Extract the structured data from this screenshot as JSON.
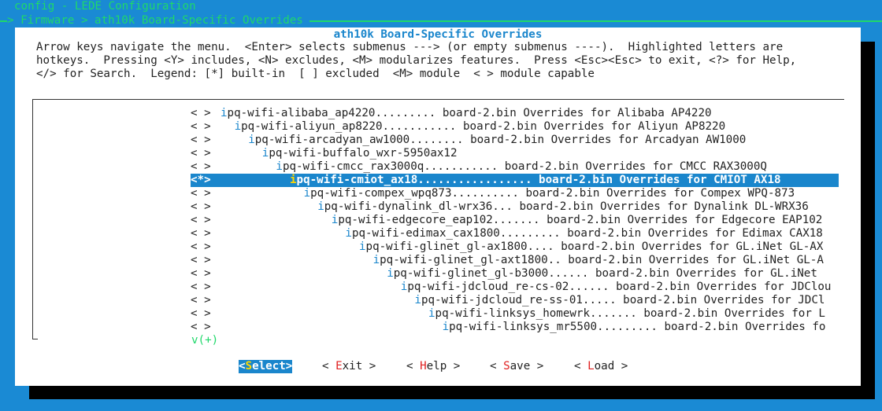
{
  "header": {
    "title": "config - LEDE Configuration",
    "breadcrumb": "> Firmware > ath10k Board-Specific Overrides"
  },
  "dialog": {
    "title": "ath10k Board-Specific Overrides",
    "help_lines": [
      "Arrow keys navigate the menu.  <Enter> selects submenus ---> (or empty submenus ----).  Highlighted letters are",
      "hotkeys.  Pressing <Y> includes, <N> excludes, <M> modularizes features.  Press <Esc><Esc> to exit, <?> for Help,",
      "</> for Search.  Legend: [*] built-in  [ ] excluded  <M> module  < > module capable"
    ]
  },
  "menu": {
    "items": [
      {
        "mark": "< >",
        "hotkey": "i",
        "rest": "pq-wifi-alibaba_ap4220......... board-2.bin Overrides for Alibaba AP4220"
      },
      {
        "mark": "< >",
        "hotkey": "i",
        "rest": "pq-wifi-aliyun_ap8220........... board-2.bin Overrides for Aliyun AP8220"
      },
      {
        "mark": "< >",
        "hotkey": "i",
        "rest": "pq-wifi-arcadyan_aw1000........ board-2.bin Overrides for Arcadyan AW1000"
      },
      {
        "mark": "< >",
        "hotkey": "i",
        "rest": "pq-wifi-buffalo_wxr-5950ax12"
      },
      {
        "mark": "< >",
        "hotkey": "i",
        "rest": "pq-wifi-cmcc_rax3000q........... board-2.bin Overrides for CMCC RAX3000Q"
      },
      {
        "mark": "<*>",
        "hotkey": "i",
        "rest": "pq-wifi-cmiot_ax18................. board-2.bin Overrides for CMIOT AX18",
        "selected": true
      },
      {
        "mark": "< >",
        "hotkey": "i",
        "rest": "pq-wifi-compex_wpq873.......... board-2.bin Overrides for Compex WPQ-873"
      },
      {
        "mark": "< >",
        "hotkey": "i",
        "rest": "pq-wifi-dynalink_dl-wrx36... board-2.bin Overrides for Dynalink DL-WRX36"
      },
      {
        "mark": "< >",
        "hotkey": "i",
        "rest": "pq-wifi-edgecore_eap102....... board-2.bin Overrides for Edgecore EAP102"
      },
      {
        "mark": "< >",
        "hotkey": "i",
        "rest": "pq-wifi-edimax_cax1800......... board-2.bin Overrides for Edimax CAX18"
      },
      {
        "mark": "< >",
        "hotkey": "i",
        "rest": "pq-wifi-glinet_gl-ax1800.... board-2.bin Overrides for GL.iNet GL-AX"
      },
      {
        "mark": "< >",
        "hotkey": "i",
        "rest": "pq-wifi-glinet_gl-axt1800.. board-2.bin Overrides for GL.iNet GL-A"
      },
      {
        "mark": "< >",
        "hotkey": "i",
        "rest": "pq-wifi-glinet_gl-b3000...... board-2.bin Overrides for GL.iNet"
      },
      {
        "mark": "< >",
        "hotkey": "i",
        "rest": "pq-wifi-jdcloud_re-cs-02...... board-2.bin Overrides for JDClou"
      },
      {
        "mark": "< >",
        "hotkey": "i",
        "rest": "pq-wifi-jdcloud_re-ss-01..... board-2.bin Overrides for JDCl"
      },
      {
        "mark": "< >",
        "hotkey": "i",
        "rest": "pq-wifi-linksys_homewrk....... board-2.bin Overrides for L"
      },
      {
        "mark": "< >",
        "hotkey": "i",
        "rest": "pq-wifi-linksys_mr5500......... board-2.bin Overrides fo"
      }
    ],
    "more_indicator": "v(+)"
  },
  "buttons": {
    "select": {
      "pre": "<",
      "hotkey": "S",
      "post": "elect>"
    },
    "exit": {
      "pre": "< ",
      "hotkey": "E",
      "post": "xit >"
    },
    "help": {
      "pre": "< ",
      "hotkey": "H",
      "post": "elp >"
    },
    "save": {
      "pre": "< ",
      "hotkey": "S",
      "post": "ave >"
    },
    "load": {
      "pre": "< ",
      "hotkey": "L",
      "post": "oad >"
    }
  },
  "colors": {
    "background": "#1a8ad4",
    "accent": "#1a86cc",
    "hotkey_button": "#e02020",
    "green_text": "#1fd86a",
    "selected_hotkey": "#ffd700"
  }
}
